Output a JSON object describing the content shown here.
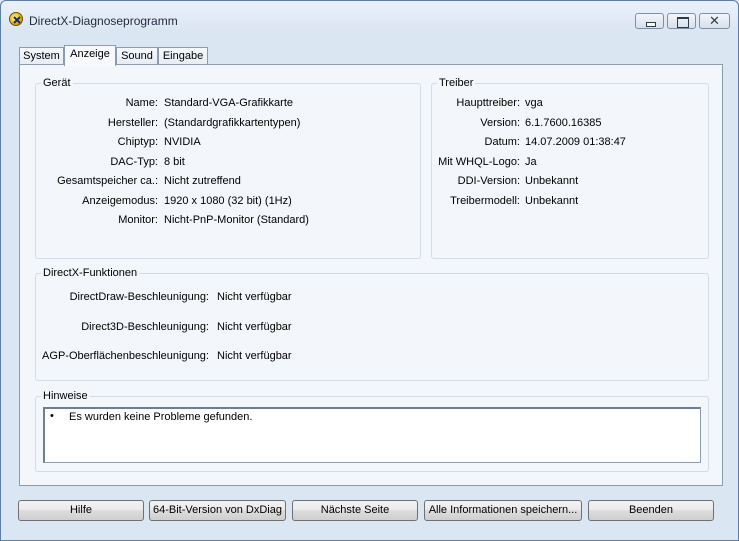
{
  "window": {
    "title": "DirectX-Diagnoseprogramm"
  },
  "tabs": [
    {
      "label": "System"
    },
    {
      "label": "Anzeige"
    },
    {
      "label": "Sound"
    },
    {
      "label": "Eingabe"
    }
  ],
  "active_tab": "Anzeige",
  "device": {
    "title": "Gerät",
    "rows": [
      {
        "label": "Name:",
        "value": "Standard-VGA-Grafikkarte"
      },
      {
        "label": "Hersteller:",
        "value": "(Standardgrafikkartentypen)"
      },
      {
        "label": "Chiptyp:",
        "value": "NVIDIA"
      },
      {
        "label": "DAC-Typ:",
        "value": "8 bit"
      },
      {
        "label": "Gesamtspeicher ca.:",
        "value": "Nicht zutreffend"
      },
      {
        "label": "Anzeigemodus:",
        "value": "1920 x 1080 (32 bit) (1Hz)"
      },
      {
        "label": "Monitor:",
        "value": "Nicht-PnP-Monitor (Standard)"
      }
    ]
  },
  "driver": {
    "title": "Treiber",
    "rows": [
      {
        "label": "Haupttreiber:",
        "value": "vga"
      },
      {
        "label": "Version:",
        "value": "6.1.7600.16385"
      },
      {
        "label": "Datum:",
        "value": "14.07.2009 01:38:47"
      },
      {
        "label": "Mit WHQL-Logo:",
        "value": "Ja"
      },
      {
        "label": "DDI-Version:",
        "value": "Unbekannt"
      },
      {
        "label": "Treibermodell:",
        "value": "Unbekannt"
      }
    ]
  },
  "features": {
    "title": "DirectX-Funktionen",
    "rows": [
      {
        "label": "DirectDraw-Beschleunigung:",
        "value": "Nicht verfügbar"
      },
      {
        "label": "Direct3D-Beschleunigung:",
        "value": "Nicht verfügbar"
      },
      {
        "label": "AGP-Oberflächenbeschleunigung:",
        "value": "Nicht verfügbar"
      }
    ]
  },
  "notes": {
    "title": "Hinweise",
    "bullet": "•",
    "items": [
      "Es wurden keine Probleme gefunden."
    ]
  },
  "buttons": {
    "help": "Hilfe",
    "dxdiag64": "64-Bit-Version von DxDiag",
    "next_page": "Nächste Seite",
    "save_all": "Alle Informationen speichern...",
    "exit": "Beenden"
  }
}
